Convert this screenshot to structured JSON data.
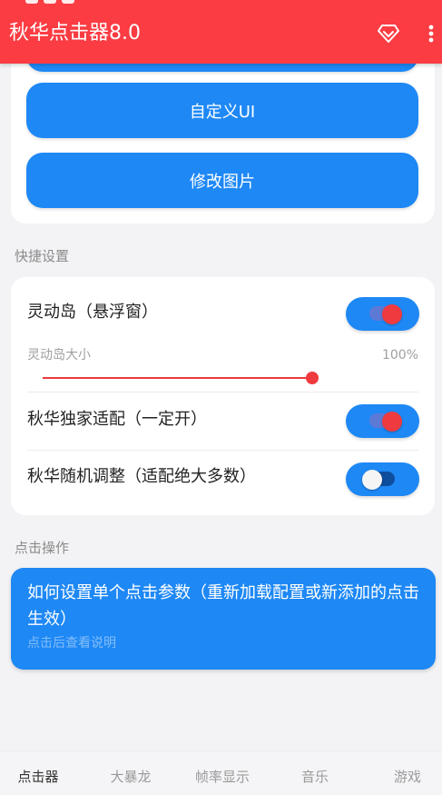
{
  "app_bar": {
    "title": "秋华点击器8.0",
    "accent_color": "#fb3c43",
    "actions": [
      "diamond-icon",
      "more-vert-icon"
    ]
  },
  "top_card": {
    "buttons": [
      {
        "label": ""
      },
      {
        "label": "自定义UI"
      },
      {
        "label": "修改图片"
      }
    ],
    "button_color": "#1e88f5"
  },
  "quick_settings": {
    "header": "快捷设置",
    "dynamic_island": {
      "label": "灵动岛（悬浮窗）",
      "enabled": true
    },
    "island_size": {
      "label": "灵动岛大小",
      "value_text": "100%",
      "value": 1.0
    },
    "exclusive_adapt": {
      "label": "秋华独家适配（一定开）",
      "enabled": true
    },
    "random_adjust": {
      "label": "秋华随机调整（适配绝大多数）",
      "enabled": false
    }
  },
  "click_ops": {
    "header": "点击操作",
    "card": {
      "title": "如何设置单个点击参数（重新加载配置或新添加的点击生效）",
      "subtitle": "点击后查看说明"
    }
  },
  "bottom_nav": {
    "items": [
      {
        "label": "点击器",
        "active": true
      },
      {
        "label": "大暴龙",
        "active": false
      },
      {
        "label": "帧率显示",
        "active": false
      },
      {
        "label": "音乐",
        "active": false
      },
      {
        "label": "游戏",
        "active": false
      }
    ]
  }
}
